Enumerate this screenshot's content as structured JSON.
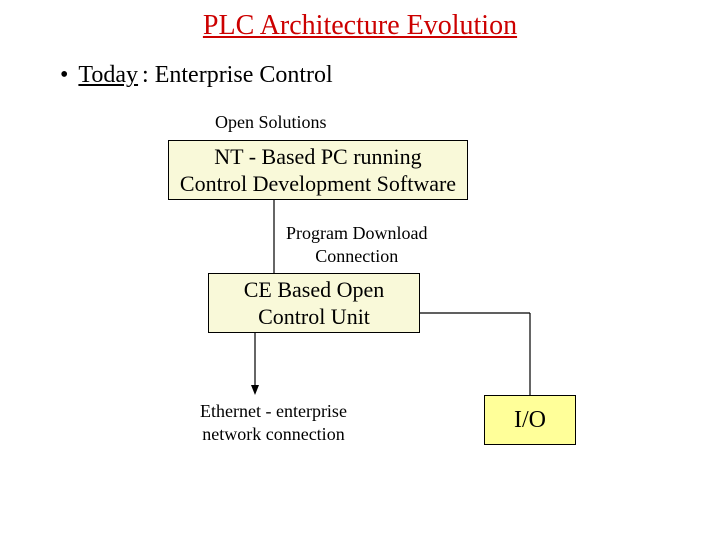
{
  "title": "PLC Architecture Evolution",
  "bullet": {
    "today": "Today",
    "rest": " :  Enterprise Control"
  },
  "labels": {
    "open_solutions": "Open Solutions",
    "program_download_l1": "Program Download",
    "program_download_l2": "Connection",
    "ethernet_l1": "Ethernet - enterprise",
    "ethernet_l2": "network connection"
  },
  "boxes": {
    "nt_l1": "NT - Based PC running",
    "nt_l2": "Control Development Software",
    "ce_l1": "CE Based Open",
    "ce_l2": "Control Unit",
    "io": "I/O"
  }
}
